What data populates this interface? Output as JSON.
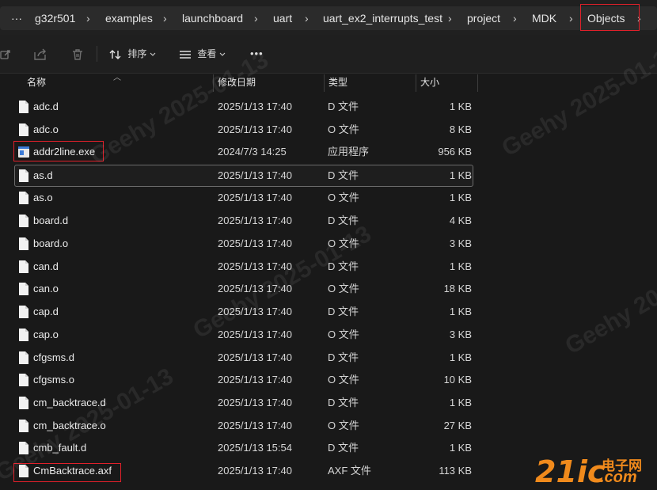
{
  "breadcrumb": {
    "more": "···",
    "items": [
      "g32r501",
      "examples",
      "launchboard",
      "uart",
      "uart_ex2_interrupts_test",
      "project",
      "MDK",
      "Objects"
    ],
    "separator": "›"
  },
  "toolbar": {
    "sort_label": "排序",
    "view_label": "查看",
    "more_label": "•••"
  },
  "columns": {
    "name": "名称",
    "date": "修改日期",
    "type": "类型",
    "size": "大小"
  },
  "files": [
    {
      "name": "adc.d",
      "date": "2025/1/13 17:40",
      "type": "D 文件",
      "size": "1 KB"
    },
    {
      "name": "adc.o",
      "date": "2025/1/13 17:40",
      "type": "O 文件",
      "size": "8 KB"
    },
    {
      "name": "addr2line.exe",
      "date": "2024/7/3 14:25",
      "type": "应用程序",
      "size": "956 KB"
    },
    {
      "name": "as.d",
      "date": "2025/1/13 17:40",
      "type": "D 文件",
      "size": "1 KB"
    },
    {
      "name": "as.o",
      "date": "2025/1/13 17:40",
      "type": "O 文件",
      "size": "1 KB"
    },
    {
      "name": "board.d",
      "date": "2025/1/13 17:40",
      "type": "D 文件",
      "size": "4 KB"
    },
    {
      "name": "board.o",
      "date": "2025/1/13 17:40",
      "type": "O 文件",
      "size": "3 KB"
    },
    {
      "name": "can.d",
      "date": "2025/1/13 17:40",
      "type": "D 文件",
      "size": "1 KB"
    },
    {
      "name": "can.o",
      "date": "2025/1/13 17:40",
      "type": "O 文件",
      "size": "18 KB"
    },
    {
      "name": "cap.d",
      "date": "2025/1/13 17:40",
      "type": "D 文件",
      "size": "1 KB"
    },
    {
      "name": "cap.o",
      "date": "2025/1/13 17:40",
      "type": "O 文件",
      "size": "3 KB"
    },
    {
      "name": "cfgsms.d",
      "date": "2025/1/13 17:40",
      "type": "D 文件",
      "size": "1 KB"
    },
    {
      "name": "cfgsms.o",
      "date": "2025/1/13 17:40",
      "type": "O 文件",
      "size": "10 KB"
    },
    {
      "name": "cm_backtrace.d",
      "date": "2025/1/13 17:40",
      "type": "D 文件",
      "size": "1 KB"
    },
    {
      "name": "cm_backtrace.o",
      "date": "2025/1/13 17:40",
      "type": "O 文件",
      "size": "27 KB"
    },
    {
      "name": "cmb_fault.d",
      "date": "2025/1/13 15:54",
      "type": "D 文件",
      "size": "1 KB"
    },
    {
      "name": "CmBacktrace.axf",
      "date": "2025/1/13 17:40",
      "type": "AXF 文件",
      "size": "113 KB"
    }
  ],
  "watermarks": [
    "Geehy 2025-01-13",
    "Geehy 2025-01-13",
    "Geehy 2025-01-13",
    "Geehy 2025-01-13",
    "Geehy 2025-01-13"
  ],
  "logo": {
    "main": "21ic",
    "cn": "电子网",
    "sub": ".com"
  },
  "colors": {
    "highlight": "#e0202a",
    "background": "#191919",
    "logo_orange": "#f08a1c"
  }
}
